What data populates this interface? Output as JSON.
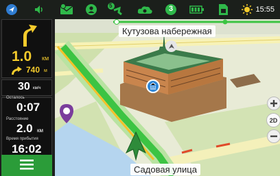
{
  "status_bar": {
    "time": "15:55",
    "satellite_count": "5",
    "badge_count": "3",
    "icons": [
      "back-arrow-icon",
      "volume-icon",
      "message-icon",
      "user-icon",
      "satellite-icon",
      "traffic-cloud-icon",
      "number-badge-icon",
      "battery-icon",
      "sim-card-icon",
      "sun-icon"
    ]
  },
  "navigation": {
    "turn_distance_value": "1.0",
    "turn_distance_unit": "км",
    "next_turn_distance_value": "740",
    "next_turn_distance_unit": "м",
    "speed_value": "30",
    "speed_unit": "км/ч",
    "remaining_time_label": "Осталось",
    "remaining_time": "0:07",
    "distance_label": "Расстояние",
    "distance_value": "2.0",
    "distance_unit": "км",
    "arrival_label": "Время прибытия",
    "arrival_time": "16:02"
  },
  "map": {
    "top_street": "Кутузова набережная",
    "bottom_street": "Садовая улица",
    "view_mode": "2D",
    "route_color": "#3cc443",
    "water_color": "#b5d5ef",
    "building_color": "#c9854d"
  }
}
